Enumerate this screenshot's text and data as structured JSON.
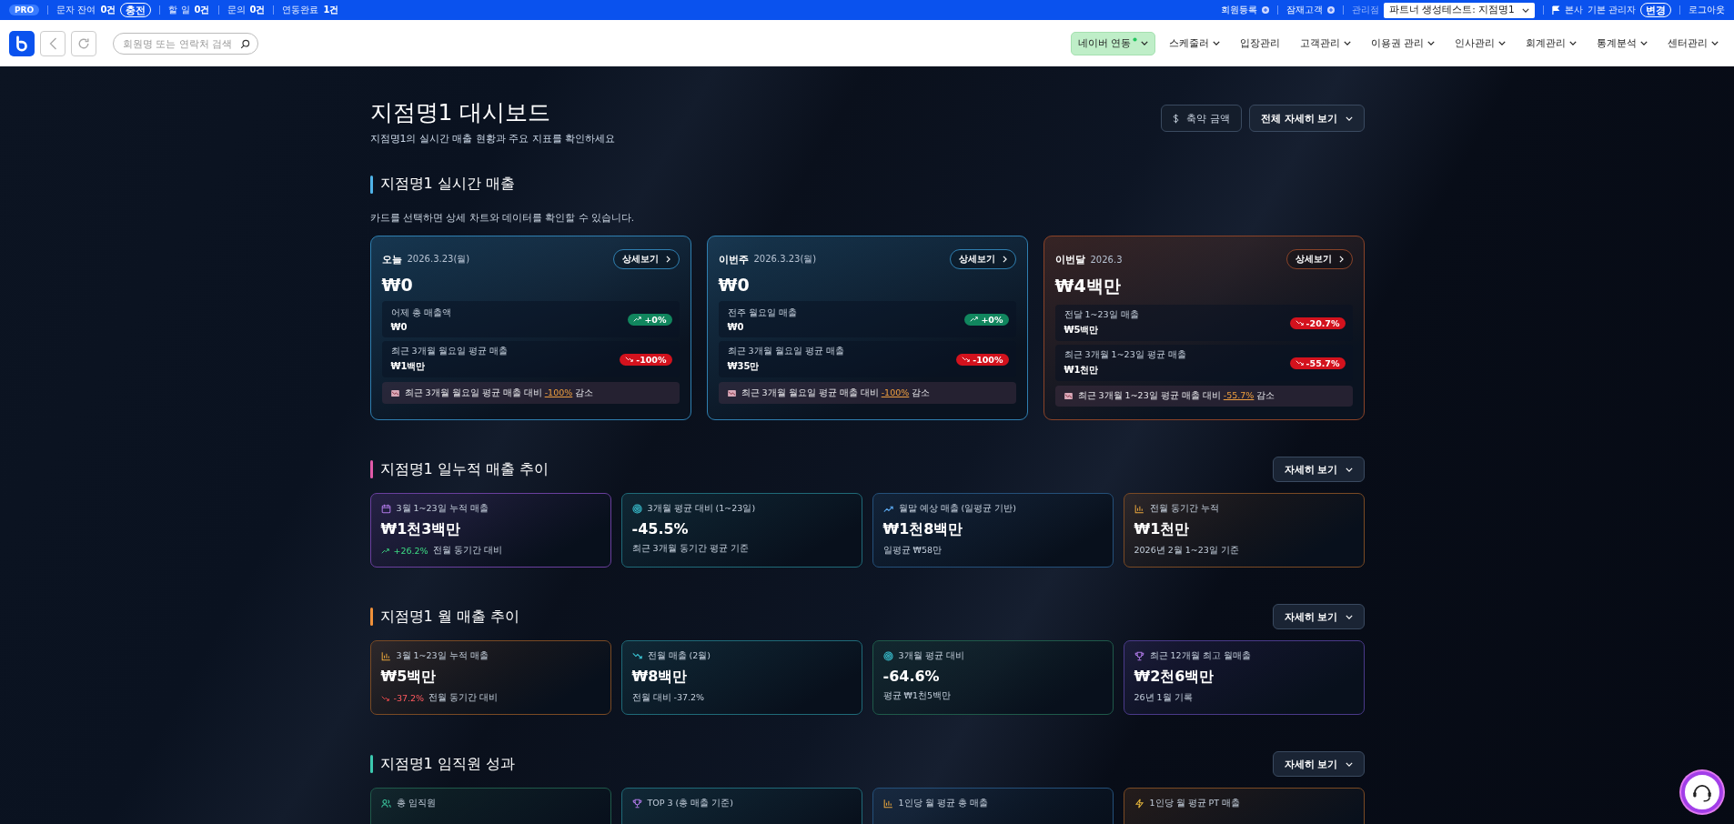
{
  "topbar": {
    "plan": "PRO",
    "stats": [
      {
        "label": "문자 잔여",
        "value": "0건",
        "action": "충전"
      },
      {
        "label": "할 일",
        "value": "0건"
      },
      {
        "label": "문의",
        "value": "0건"
      },
      {
        "label": "연동완료",
        "value": "1건"
      }
    ],
    "links": [
      "회원등록",
      "잠재고객"
    ],
    "branch_label": "관리점",
    "branch_select": "파트너 생성테스트: 지점명1",
    "hq": "본사",
    "admin": "기본 관리자",
    "change": "변경",
    "logout": "로그아웃"
  },
  "header": {
    "search": {
      "placeholder": "회원명 또는 연락처 검색"
    },
    "nav": [
      {
        "label": "네이버 연동",
        "highlighted": true,
        "dot": true,
        "caret": true
      },
      {
        "label": "스케줄러",
        "highlighted": false,
        "dot": false,
        "caret": true
      },
      {
        "label": "입장관리",
        "highlighted": false,
        "dot": false,
        "caret": false
      },
      {
        "label": "고객관리",
        "highlighted": false,
        "dot": false,
        "caret": true
      },
      {
        "label": "이용권 관리",
        "highlighted": false,
        "dot": false,
        "caret": true
      },
      {
        "label": "인사관리",
        "highlighted": false,
        "dot": false,
        "caret": true
      },
      {
        "label": "회계관리",
        "highlighted": false,
        "dot": false,
        "caret": true
      },
      {
        "label": "통계분석",
        "highlighted": false,
        "dot": false,
        "caret": true
      },
      {
        "label": "센터관리",
        "highlighted": false,
        "dot": false,
        "caret": true
      }
    ]
  },
  "dashboard": {
    "title": "지점명1 대시보드",
    "subtitle": "지점명1의 실시간 매출 현황과 주요 지표를 확인하세요",
    "compact_button": "축약 금액",
    "detail_all_button": "전체 자세히 보기"
  },
  "realtime": {
    "title": "지점명1 실시간 매출",
    "color": "#4fb3e8",
    "description": "카드를 선택하면 상세 차트와 데이터를 확인할 수 있습니다.",
    "cards": [
      {
        "label": "오늘",
        "date": "2026.3.23(월)",
        "button": "상세보기",
        "amount": "₩0",
        "color": "#2f7fb0",
        "rows": [
          {
            "label": "어제 총 매출액",
            "value": "₩0",
            "change": "+0%",
            "up": true
          },
          {
            "label": "최근 3개월 월요일 평균 매출",
            "value": "₩1백만",
            "change": "-100%",
            "up": false
          }
        ],
        "note": {
          "pre": "최근 3개월 월요일 평균 매출 대비",
          "highlight": "-100%",
          "post": "감소"
        }
      },
      {
        "label": "이번주",
        "date": "2026.3.23(월)",
        "button": "상세보기",
        "amount": "₩0",
        "color": "#2f7fb0",
        "rows": [
          {
            "label": "전주 월요일 매출",
            "value": "₩0",
            "change": "+0%",
            "up": true
          },
          {
            "label": "최근 3개월 월요일 평균 매출",
            "value": "₩35만",
            "change": "-100%",
            "up": false
          }
        ],
        "note": {
          "pre": "최근 3개월 월요일 평균 매출 대비",
          "highlight": "-100%",
          "post": "감소"
        }
      },
      {
        "label": "이번달",
        "date": "2026.3",
        "button": "상세보기",
        "amount": "₩4백만",
        "color": "#8a4328",
        "rows": [
          {
            "label": "전달 1~23일 매출",
            "value": "₩5백만",
            "change": "-20.7%",
            "up": false
          },
          {
            "label": "최근 3개월 1~23일 평균 매출",
            "value": "₩1천만",
            "change": "-55.7%",
            "up": false
          }
        ],
        "note": {
          "pre": "최근 3개월 1~23일 평균 매출 대비",
          "highlight": "-55.7%",
          "post": "감소"
        }
      }
    ]
  },
  "sections": [
    {
      "title": "지점명1 일누적 매출 추이",
      "color": "#e05aa8",
      "button": "자세히 보기",
      "cards": [
        {
          "kind": "calendar",
          "label": "3월 1~23일 누적 매출",
          "value": "₩1천3백만",
          "change": "+26.2%",
          "up": true,
          "sub": "전월 동기간 대비",
          "color": "#6a3f9e"
        },
        {
          "kind": "target",
          "label": "3개월 평균 대비 (1~23일)",
          "value": "-45.5%",
          "sub": "최근 3개월 동기간 평균 기준",
          "color": "#1f6a78"
        },
        {
          "kind": "trend-up",
          "label": "월말 예상 매출 (일평균 기반)",
          "value": "₩1천8백만",
          "sub": "일평균 ₩58만",
          "color": "#24507a"
        },
        {
          "kind": "bar-chart",
          "label": "전월 동기간 누적",
          "value": "₩1천만",
          "sub": "2026년 2월 1~23일 기준",
          "color": "#7a4a24"
        }
      ]
    },
    {
      "title": "지점명1 월 매출 추이",
      "color": "#f0913a",
      "button": "자세히 보기",
      "cards": [
        {
          "kind": "bar-chart",
          "label": "3월 1~23일 누적 매출",
          "value": "₩5백만",
          "change": "-37.2%",
          "up": false,
          "sub": "전월 동기간 대비",
          "color": "#7a4a24"
        },
        {
          "kind": "trend-down",
          "label": "전월 매출 (2월)",
          "value": "₩8백만",
          "sub": "전월 대비 -37.2%",
          "color": "#1f6a78"
        },
        {
          "kind": "target",
          "label": "3개월 평균 대비",
          "value": "-64.6%",
          "sub": "평균 ₩1천5백만",
          "color": "#1f5a4a"
        },
        {
          "kind": "trophy",
          "label": "최근 12개월 최고 월매출",
          "value": "₩2천6백만",
          "sub": "26년 1월 기록",
          "color": "#4a3a8a"
        }
      ]
    },
    {
      "title": "지점명1 임직원 성과",
      "color": "#3cc9b0",
      "button": "자세히 보기",
      "cards": [
        {
          "kind": "users",
          "label": "총 임직원",
          "color": "#1f5a4a"
        },
        {
          "kind": "trophy",
          "label": "TOP 3 (총 매출 기준)",
          "color": "#1f6a78"
        },
        {
          "kind": "bar-chart",
          "label": "1인당 월 평균 총 매출",
          "color": "#24507a"
        },
        {
          "kind": "bolt",
          "label": "1인당 월 평균 PT 매출",
          "color": "#7a4a24"
        }
      ]
    }
  ]
}
